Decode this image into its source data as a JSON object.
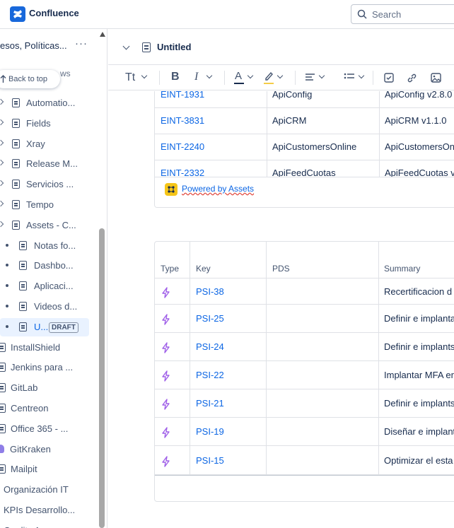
{
  "app": {
    "title": "Confluence"
  },
  "search": {
    "placeholder": "Search"
  },
  "sidebar": {
    "space_title": "esos, Políticas...",
    "more": "···",
    "back_to_top": "Back to top",
    "back_to_top_tail": "ws",
    "items": [
      {
        "label": "Automatio...",
        "indent": 1
      },
      {
        "label": "Fields",
        "indent": 1
      },
      {
        "label": "Xray",
        "indent": 1
      },
      {
        "label": "Release M...",
        "indent": 1
      },
      {
        "label": "Servicios ...",
        "indent": 1
      },
      {
        "label": "Tempo",
        "indent": 1
      },
      {
        "label": "Assets - C...",
        "indent": 1
      },
      {
        "label": "Notas fo...",
        "indent": 2
      },
      {
        "label": "Dashbo...",
        "indent": 2
      },
      {
        "label": "Aplicaci...",
        "indent": 2
      },
      {
        "label": "Videos d...",
        "indent": 2
      },
      {
        "label": "U...",
        "indent": 2,
        "badge": "DRAFT"
      },
      {
        "label": "InstallShield",
        "indent": 0
      },
      {
        "label": "Jenkins para ...",
        "indent": 0
      },
      {
        "label": "GitLab",
        "indent": 0
      },
      {
        "label": "Centreon",
        "indent": 0
      },
      {
        "label": "Office 365 - ...",
        "indent": 0
      },
      {
        "label": "GitKraken",
        "indent": 0
      },
      {
        "label": "Mailpit",
        "indent": 0
      },
      {
        "label": "Organización IT",
        "indent": -1
      },
      {
        "label": "KPIs Desarrollo...",
        "indent": -1
      },
      {
        "label": "Quality Assuran...",
        "indent": -1
      }
    ]
  },
  "page": {
    "title": "Untitled"
  },
  "toolbar": {
    "text_style": "Tt"
  },
  "assets_table": {
    "rows": [
      {
        "key": "EINT-1931",
        "name": "ApiConfig",
        "summary": "ApiConfig v2.8.0"
      },
      {
        "key": "EINT-3831",
        "name": "ApiCRM",
        "summary": "ApiCRM v1.1.0"
      },
      {
        "key": "EINT-2240",
        "name": "ApiCustomersOnline",
        "summary": "ApiCustomersOnline"
      },
      {
        "key": "EINT-2332",
        "name": "ApiFeedCuotas",
        "summary": "ApiFeedCuotas v"
      }
    ],
    "powered_by": "Powered by Assets"
  },
  "jira_table": {
    "headers": {
      "type": "Type",
      "key": "Key",
      "pds": "PDS",
      "summary": "Summary"
    },
    "rows": [
      {
        "key": "PSI-38",
        "summary": "Recertificacion d"
      },
      {
        "key": "PSI-25",
        "summary": "Definir e implanta"
      },
      {
        "key": "PSI-24",
        "summary": "Definir e implants"
      },
      {
        "key": "PSI-22",
        "summary": "Implantar MFA er"
      },
      {
        "key": "PSI-21",
        "summary": "Definir e implants"
      },
      {
        "key": "PSI-19",
        "summary": "Diseñar e implant"
      },
      {
        "key": "PSI-15",
        "summary": "Optimizar el esta"
      }
    ]
  }
}
